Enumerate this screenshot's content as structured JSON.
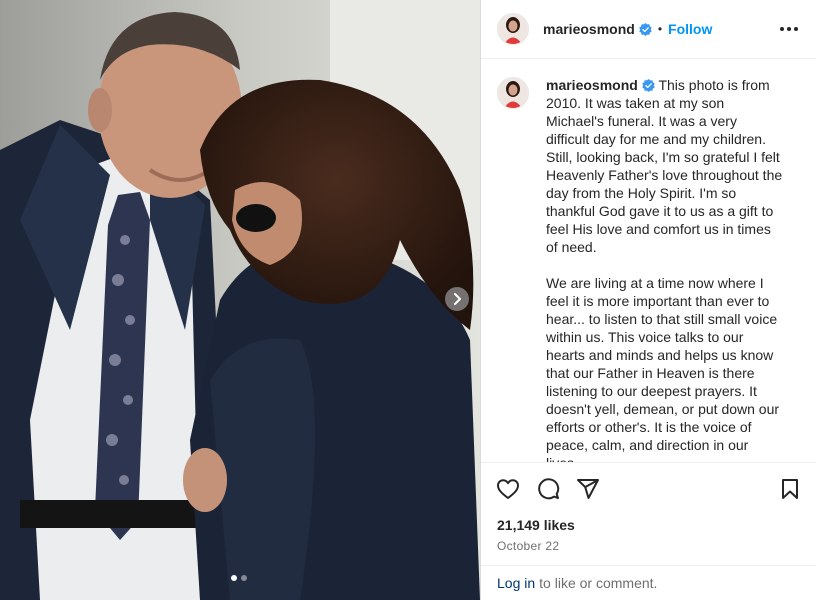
{
  "post": {
    "username": "marieosmond",
    "verified": true,
    "separator": "•",
    "follow_label": "Follow",
    "caption": "This photo is from 2010. It was taken at my son Michael's funeral. It was a very difficult day for me and my children. Still, looking back, I'm so grateful I felt Heavenly Father's love throughout the day from the Holy Spirit. I'm so thankful God gave it to us as a gift to feel His love and comfort us in times of need.\n\nWe are living at a time now where I feel it is more important than ever to hear... to listen to that still small voice within us. This voice talks to our hearts and minds and helps us know that our Father in Heaven is there listening to our deepest prayers. It doesn't yell, demean, or put down our efforts or other's. It is the voice of peace, calm, and direction in our lives.",
    "likes": "21,149 likes",
    "date": "October 22"
  },
  "carousel": {
    "current_slide": 1,
    "total_slides": 2
  },
  "footer": {
    "login_label": "Log in",
    "login_suffix": "to like or comment."
  },
  "icons": {
    "verified": "verified-badge-icon",
    "like": "heart-icon",
    "comment": "comment-icon",
    "share": "paper-plane-icon",
    "save": "bookmark-icon",
    "more": "more-options-icon",
    "next": "chevron-right-icon"
  },
  "colors": {
    "accent": "#0095f6",
    "verified": "#3897f0",
    "text": "#262626",
    "muted": "#6f6f6f",
    "link": "#00376b"
  }
}
